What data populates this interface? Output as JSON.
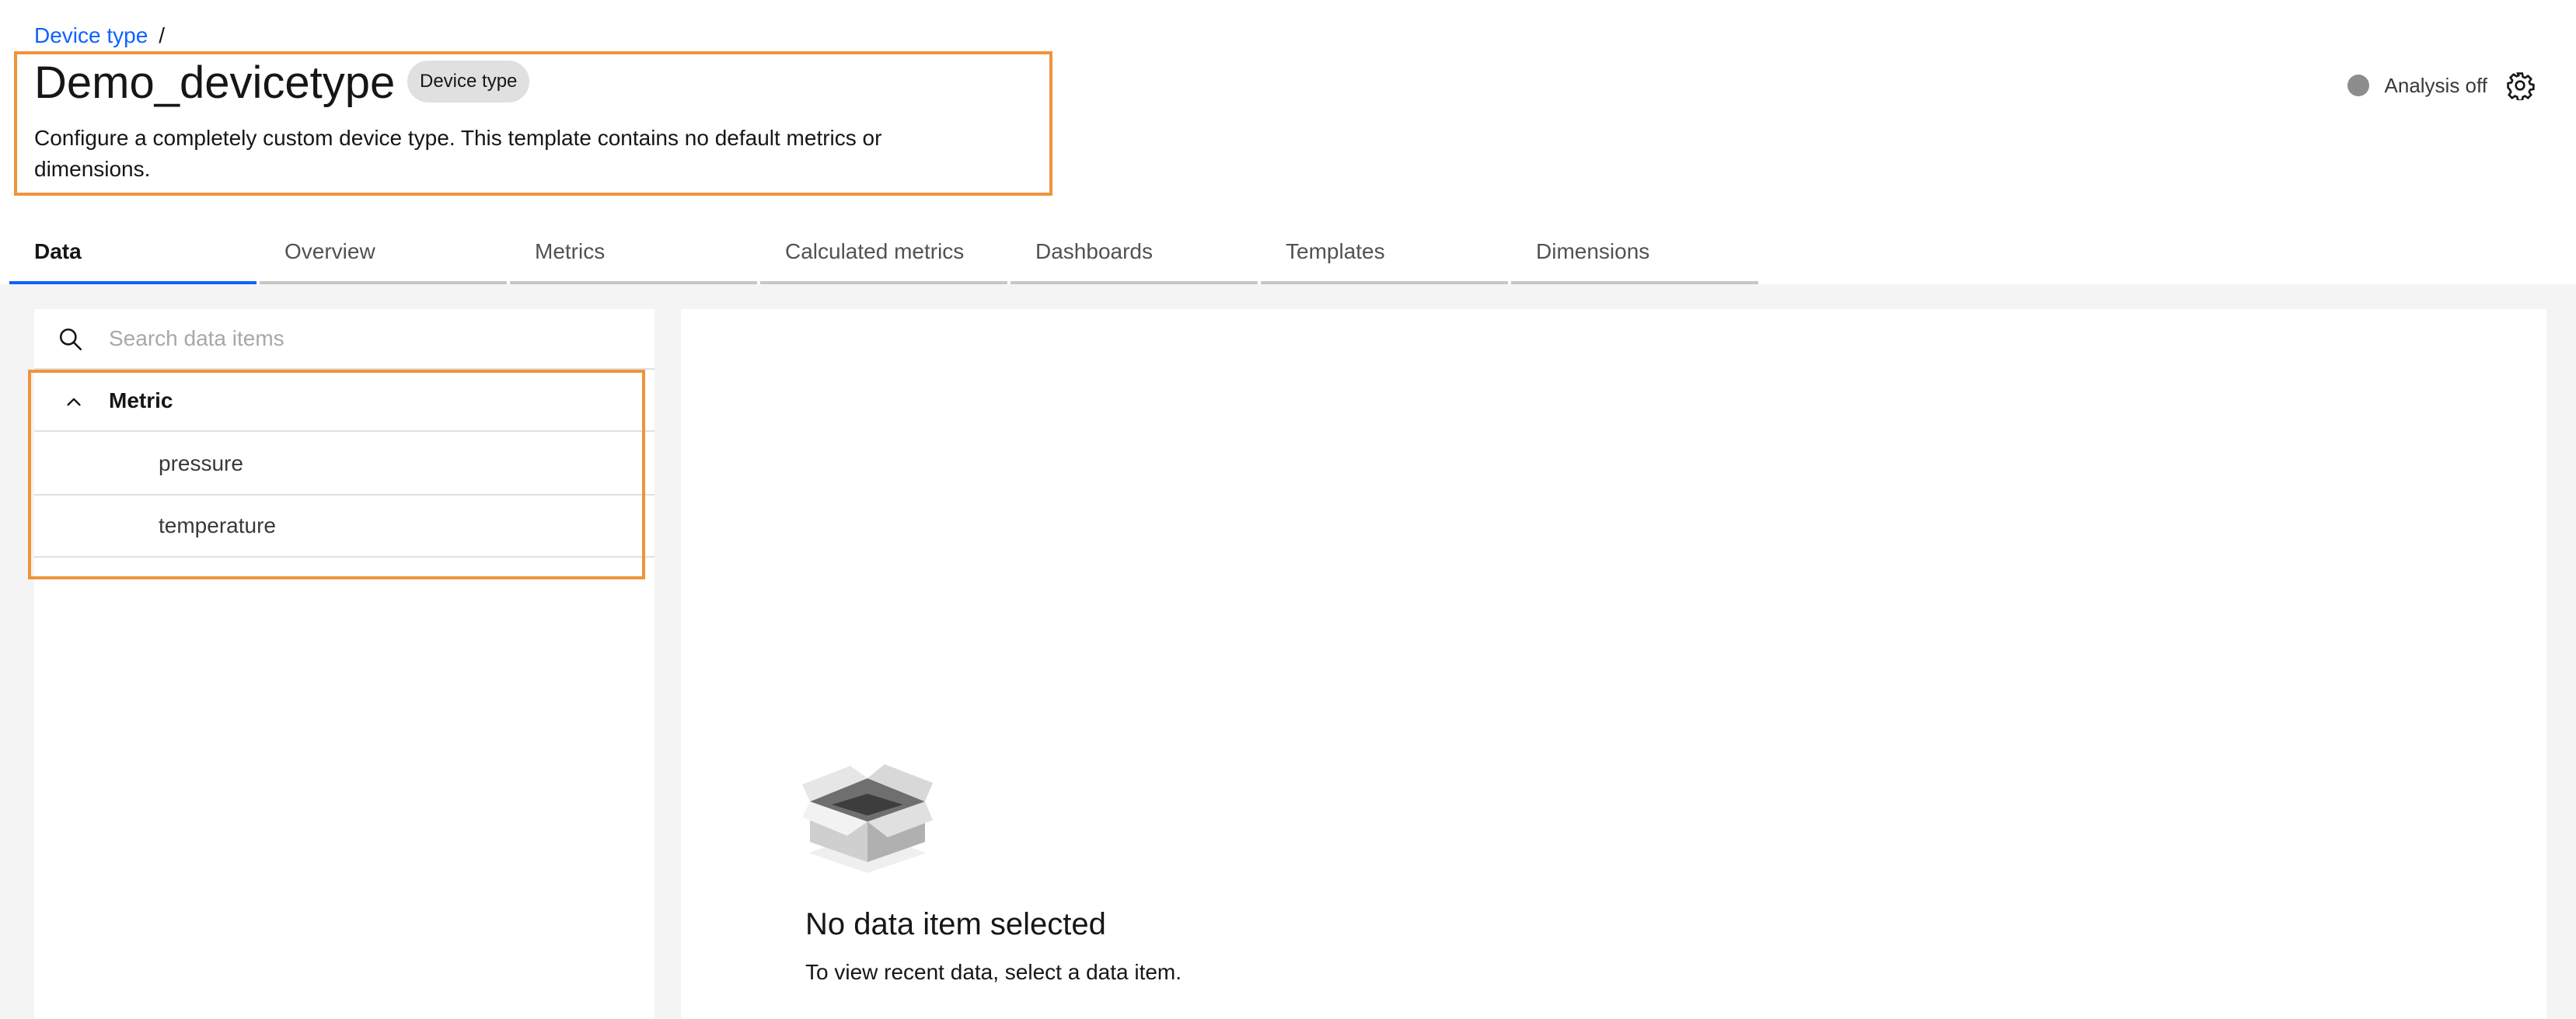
{
  "breadcrumb": {
    "link": "Device type",
    "separator": "/"
  },
  "header": {
    "title": "Demo_devicetype",
    "tag": "Device type",
    "description": "Configure a completely custom device type. This template contains no default metrics or dimensions."
  },
  "analysis": {
    "label": "Analysis off",
    "status_color": "#8d8d8d",
    "settings_icon": "gear-icon"
  },
  "tabs": [
    {
      "label": "Data",
      "active": true
    },
    {
      "label": "Overview"
    },
    {
      "label": "Metrics"
    },
    {
      "label": "Calculated metrics"
    },
    {
      "label": "Dashboards"
    },
    {
      "label": "Templates"
    },
    {
      "label": "Dimensions"
    }
  ],
  "search": {
    "placeholder": "Search data items",
    "value": ""
  },
  "tree": {
    "group_label": "Metric",
    "expanded": true,
    "items": [
      {
        "label": "pressure"
      },
      {
        "label": "temperature"
      }
    ]
  },
  "empty_state": {
    "icon": "empty-box-icon",
    "title": "No data item selected",
    "description": "To view recent data, select a data item."
  },
  "colors": {
    "accent": "#0f62fe",
    "highlight": "#f0943a",
    "background": "#f4f4f4"
  }
}
